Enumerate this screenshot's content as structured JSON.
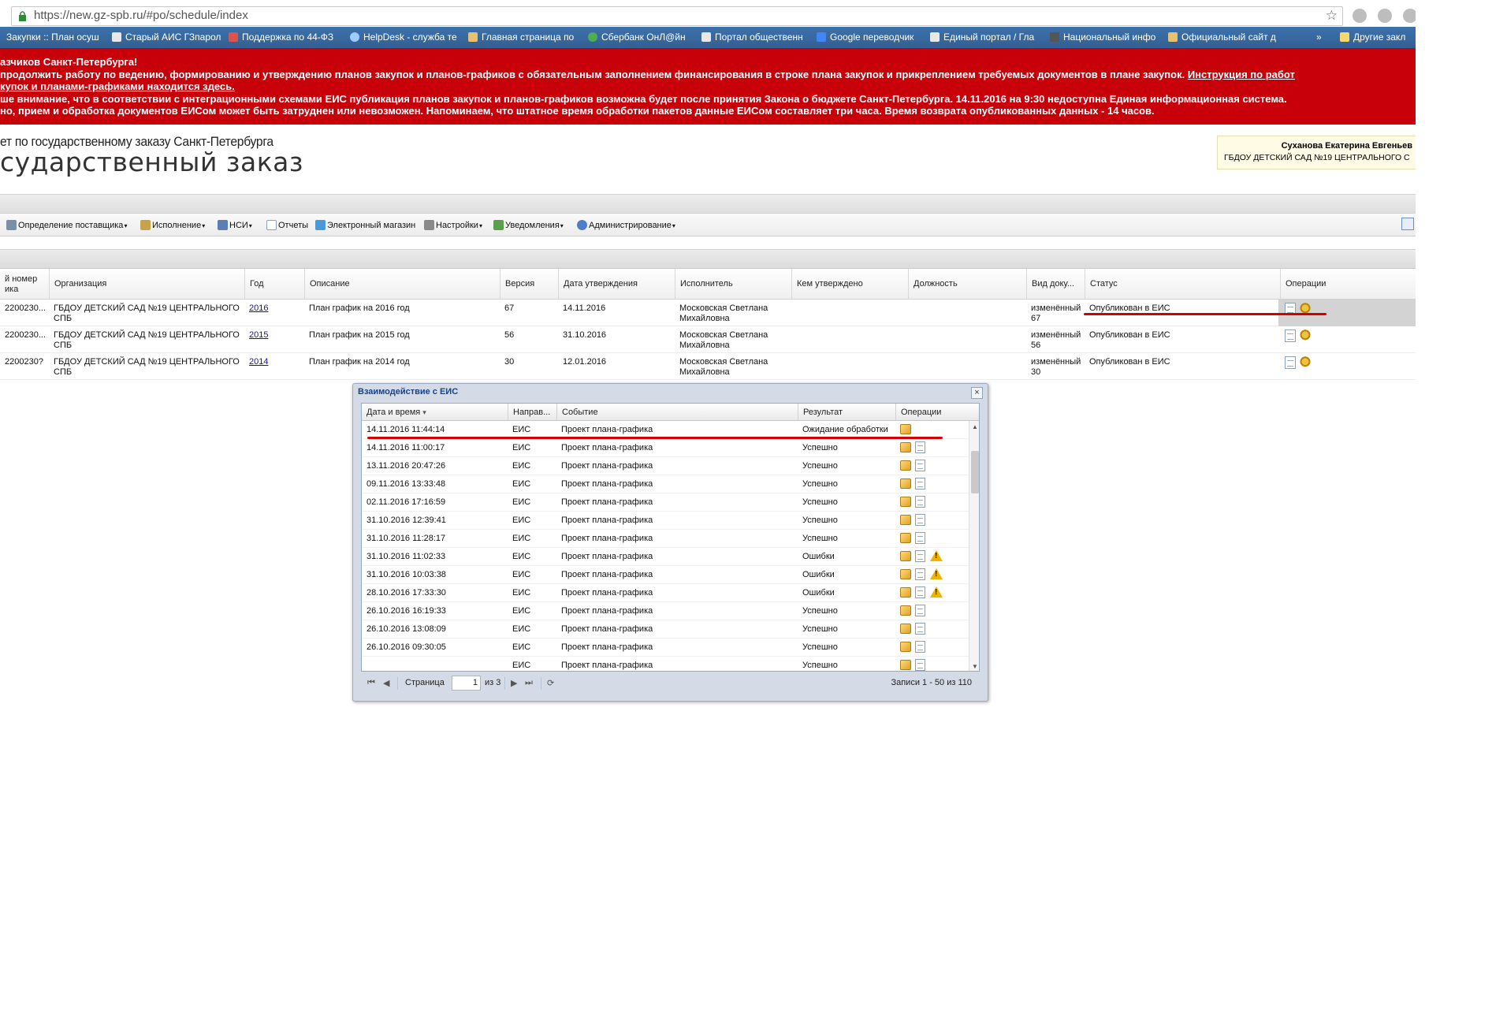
{
  "browser": {
    "url": "https://new.gz-spb.ru/#po/schedule/index",
    "bookmarks": [
      "Закупки :: План осуш",
      "Старый АИС ГЗпарол",
      "Поддержка по 44-ФЗ",
      "HelpDesk - служба те",
      "Главная страница по",
      "Сбербанк ОнЛ@йн",
      "Портал общественн",
      "Google переводчик",
      "Единый портал / Гла",
      "Национальный инфо",
      "Официальный сайт д"
    ],
    "more": "»",
    "other_bookmarks": "Другие закл"
  },
  "notice": {
    "line1": "азчиков Санкт-Петербурга!",
    "line2": "продолжить работу по ведению, формированию и утверждению планов закупок и планов-графиков с обязательным заполнением финансирования в строке плана закупок и прикреплением требуемых документов в плане закупок.",
    "line2_link": "Инструкция по работ",
    "line3_link": "купок и планами-графиками находится здесь.",
    "line4": "ше внимание, что в соответствии с интеграционными схемами ЕИС публикация планов закупок и планов-графиков возможна будет после принятия Закона о бюджете Санкт-Петербурга. 14.11.2016 на 9:30 недоступна Единая информационная система.",
    "line5": "но, прием и обработка документов ЕИСом может быть затруднен или невозможен. Напоминаем, что штатное время обработки пакетов данные ЕИСом составляет три часа. Время возврата опубликованных данных - 14 часов."
  },
  "header": {
    "subtitle": "ет по государственному заказу Санкт-Петербурга",
    "title": "сударственный заказ",
    "user_name": "Суханова Екатерина Евгеньев",
    "user_org": "ГБДОУ ДЕТСКИЙ САД №19 ЦЕНТРАЛЬНОГО С"
  },
  "menu": [
    {
      "label": "Определение поставщика",
      "icon": "gear-people-icon"
    },
    {
      "label": "Исполнение",
      "icon": "execution-icon"
    },
    {
      "label": "НСИ",
      "icon": "nsi-icon"
    },
    {
      "label": "Отчеты",
      "icon": "report-icon"
    },
    {
      "label": "Электронный магазин",
      "icon": "shop-icon"
    },
    {
      "label": "Настройки",
      "icon": "wrench-icon"
    },
    {
      "label": "Уведомления",
      "icon": "notification-icon"
    },
    {
      "label": "Администрирование",
      "icon": "user-admin-icon"
    }
  ],
  "grid": {
    "columns": [
      "й номер\nика",
      "Организация",
      "Год",
      "Описание",
      "Версия",
      "Дата утверждения",
      "Исполнитель",
      "Кем утверждено",
      "Должность",
      "Вид доку...",
      "Статус",
      "Операции"
    ],
    "rows": [
      {
        "num": "2200230...",
        "org": "ГБДОУ ДЕТСКИЙ САД №19 ЦЕНТРАЛЬНОГО СПБ",
        "year": "2016",
        "desc": "План график на 2016 год",
        "version": "67",
        "date": "14.11.2016",
        "executor": "Московская Светлана Михайловна",
        "approved_by": "",
        "position": "",
        "doc_type": "изменённый 67",
        "status": "Опубликован в ЕИС"
      },
      {
        "num": "2200230...",
        "org": "ГБДОУ ДЕТСКИЙ САД №19 ЦЕНТРАЛЬНОГО СПБ",
        "year": "2015",
        "desc": "План график на 2015 год",
        "version": "56",
        "date": "31.10.2016",
        "executor": "Московская Светлана Михайловна",
        "approved_by": "",
        "position": "",
        "doc_type": "изменённый 56",
        "status": "Опубликован в ЕИС"
      },
      {
        "num": "2200230?",
        "org": "ГБДОУ ДЕТСКИЙ САД №19 ЦЕНТРАЛЬНОГО СПБ",
        "year": "2014",
        "desc": "План график на 2014 год",
        "version": "30",
        "date": "12.01.2016",
        "executor": "Московская Светлана Михайловна",
        "approved_by": "",
        "position": "",
        "doc_type": "изменённый 30",
        "status": "Опубликован в ЕИС"
      }
    ]
  },
  "modal": {
    "title": "Взаимодействие с ЕИС",
    "close": "×",
    "columns": [
      "Дата и время",
      "Направ...",
      "Событие",
      "Результат",
      "Операции"
    ],
    "sort_indicator": "▾",
    "rows": [
      {
        "dt": "14.11.2016 11:44:14",
        "dir": "ЕИС",
        "event": "Проект плана-графика",
        "result": "Ожидание обработки",
        "icons": [
          "package"
        ]
      },
      {
        "dt": "14.11.2016 11:00:17",
        "dir": "ЕИС",
        "event": "Проект плана-графика",
        "result": "Успешно",
        "icons": [
          "package",
          "document"
        ]
      },
      {
        "dt": "13.11.2016 20:47:26",
        "dir": "ЕИС",
        "event": "Проект плана-графика",
        "result": "Успешно",
        "icons": [
          "package",
          "document"
        ]
      },
      {
        "dt": "09.11.2016 13:33:48",
        "dir": "ЕИС",
        "event": "Проект плана-графика",
        "result": "Успешно",
        "icons": [
          "package",
          "document"
        ]
      },
      {
        "dt": "02.11.2016 17:16:59",
        "dir": "ЕИС",
        "event": "Проект плана-графика",
        "result": "Успешно",
        "icons": [
          "package",
          "document"
        ]
      },
      {
        "dt": "31.10.2016 12:39:41",
        "dir": "ЕИС",
        "event": "Проект плана-графика",
        "result": "Успешно",
        "icons": [
          "package",
          "document"
        ]
      },
      {
        "dt": "31.10.2016 11:28:17",
        "dir": "ЕИС",
        "event": "Проект плана-графика",
        "result": "Успешно",
        "icons": [
          "package",
          "document"
        ]
      },
      {
        "dt": "31.10.2016 11:02:33",
        "dir": "ЕИС",
        "event": "Проект плана-графика",
        "result": "Ошибки",
        "icons": [
          "package",
          "document",
          "warning"
        ]
      },
      {
        "dt": "31.10.2016 10:03:38",
        "dir": "ЕИС",
        "event": "Проект плана-графика",
        "result": "Ошибки",
        "icons": [
          "package",
          "document",
          "warning"
        ]
      },
      {
        "dt": "28.10.2016 17:33:30",
        "dir": "ЕИС",
        "event": "Проект плана-графика",
        "result": "Ошибки",
        "icons": [
          "package",
          "document",
          "warning"
        ]
      },
      {
        "dt": "26.10.2016 16:19:33",
        "dir": "ЕИС",
        "event": "Проект плана-графика",
        "result": "Успешно",
        "icons": [
          "package",
          "document"
        ]
      },
      {
        "dt": "26.10.2016 13:08:09",
        "dir": "ЕИС",
        "event": "Проект плана-графика",
        "result": "Успешно",
        "icons": [
          "package",
          "document"
        ]
      },
      {
        "dt": "26.10.2016 09:30:05",
        "dir": "ЕИС",
        "event": "Проект плана-графика",
        "result": "Успешно",
        "icons": [
          "package",
          "document"
        ]
      },
      {
        "dt": "",
        "dir": "ЕИС",
        "event": "Проект плана-графика",
        "result": "Успешно",
        "icons": [
          "package",
          "document"
        ]
      }
    ],
    "pager": {
      "page_label": "Страница",
      "page_value": "1",
      "of_label": "из 3",
      "records": "Записи 1 - 50 из 110"
    }
  },
  "colors": {
    "notice_bg": "#c8000a",
    "highlight_line": "#d40000",
    "modal_title": "#15428b",
    "bookmarks_bg": "#3b6ea5"
  }
}
